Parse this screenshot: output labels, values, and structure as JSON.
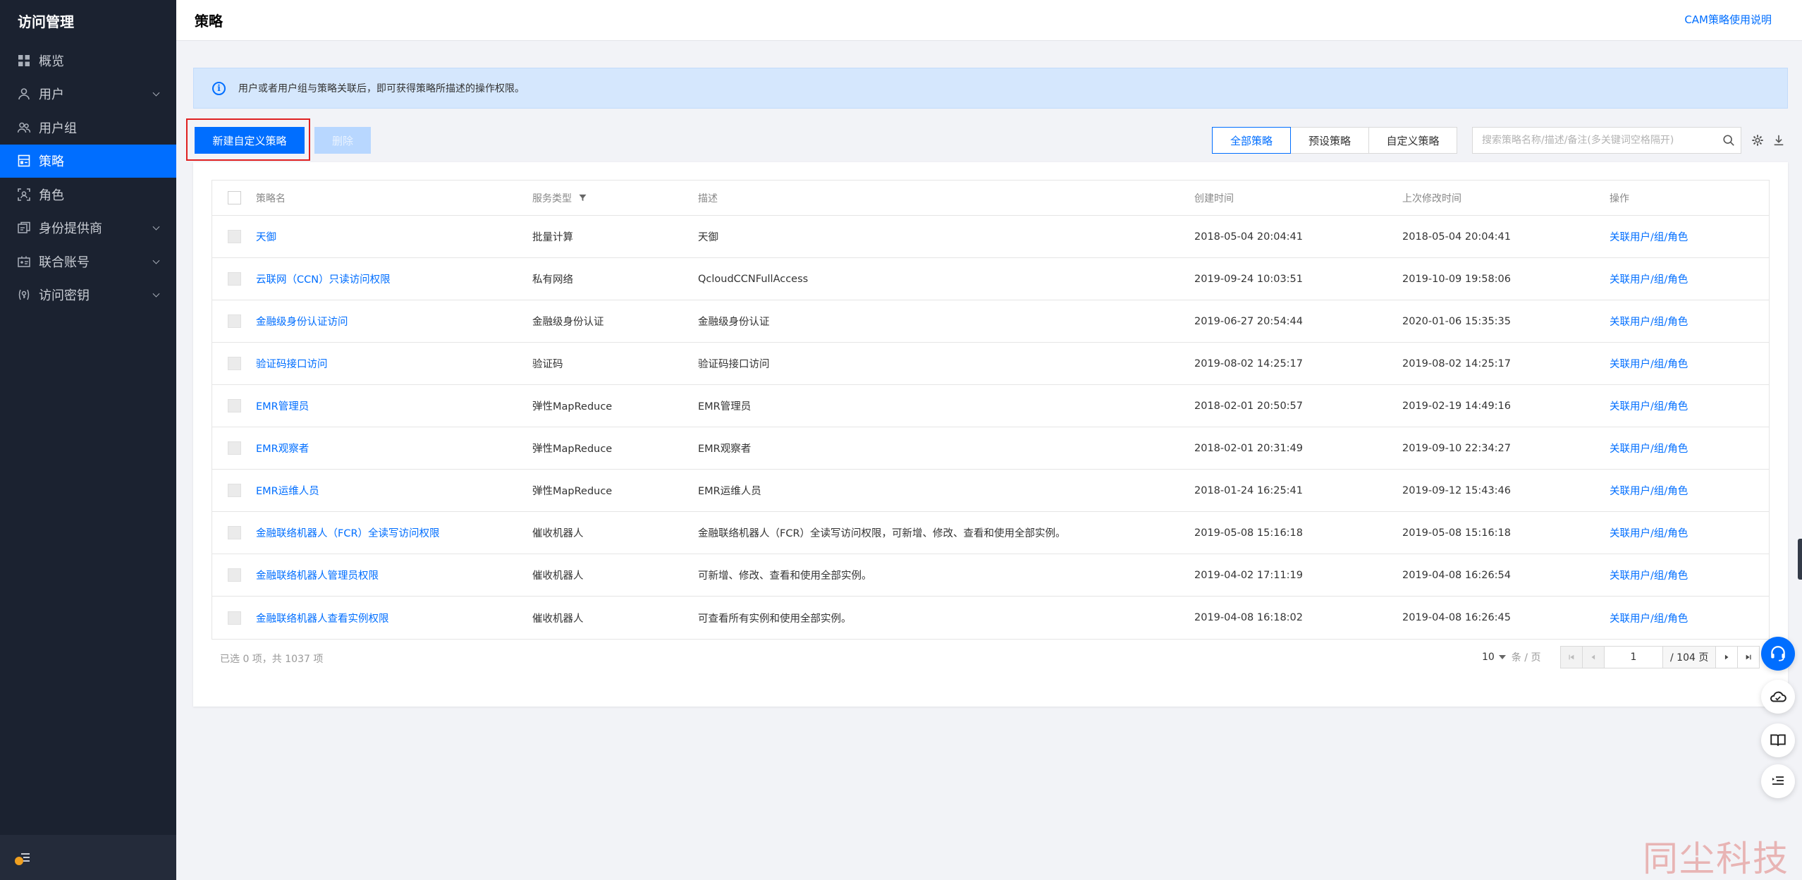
{
  "sidebar": {
    "title": "访问管理",
    "items": [
      {
        "label": "概览",
        "icon": "dashboard-icon",
        "active": false,
        "expandable": false
      },
      {
        "label": "用户",
        "icon": "user-icon",
        "active": false,
        "expandable": true
      },
      {
        "label": "用户组",
        "icon": "user-group-icon",
        "active": false,
        "expandable": false
      },
      {
        "label": "策略",
        "icon": "policy-icon",
        "active": true,
        "expandable": false
      },
      {
        "label": "角色",
        "icon": "role-icon",
        "active": false,
        "expandable": false
      },
      {
        "label": "身份提供商",
        "icon": "identity-provider-icon",
        "active": false,
        "expandable": true
      },
      {
        "label": "联合账号",
        "icon": "federated-account-icon",
        "active": false,
        "expandable": true
      },
      {
        "label": "访问密钥",
        "icon": "access-key-icon",
        "active": false,
        "expandable": true
      }
    ]
  },
  "header": {
    "title": "策略",
    "doc_link": "CAM策略使用说明"
  },
  "banner": {
    "text": "用户或者用户组与策略关联后，即可获得策略所描述的操作权限。"
  },
  "toolbar": {
    "create_label": "新建自定义策略",
    "delete_label": "删除",
    "filters": [
      "全部策略",
      "预设策略",
      "自定义策略"
    ],
    "active_filter": 0,
    "search_placeholder": "搜索策略名称/描述/备注(多关键词空格隔开)"
  },
  "table": {
    "headers": {
      "name": "策略名",
      "service": "服务类型",
      "description": "描述",
      "created": "创建时间",
      "updated": "上次修改时间",
      "operation": "操作"
    },
    "rows": [
      {
        "name": "天御",
        "service": "批量计算",
        "description": "天御",
        "created": "2018-05-04 20:04:41",
        "updated": "2018-05-04 20:04:41",
        "operation": "关联用户/组/角色"
      },
      {
        "name": "云联网（CCN）只读访问权限",
        "service": "私有网络",
        "description": "QcloudCCNFullAccess",
        "created": "2019-09-24 10:03:51",
        "updated": "2019-10-09 19:58:06",
        "operation": "关联用户/组/角色"
      },
      {
        "name": "金融级身份认证访问",
        "service": "金融级身份认证",
        "description": "金融级身份认证",
        "created": "2019-06-27 20:54:44",
        "updated": "2020-01-06 15:35:35",
        "operation": "关联用户/组/角色"
      },
      {
        "name": "验证码接口访问",
        "service": "验证码",
        "description": "验证码接口访问",
        "created": "2019-08-02 14:25:17",
        "updated": "2019-08-02 14:25:17",
        "operation": "关联用户/组/角色"
      },
      {
        "name": "EMR管理员",
        "service": "弹性MapReduce",
        "description": "EMR管理员",
        "created": "2018-02-01 20:50:57",
        "updated": "2019-02-19 14:49:16",
        "operation": "关联用户/组/角色"
      },
      {
        "name": "EMR观察者",
        "service": "弹性MapReduce",
        "description": "EMR观察者",
        "created": "2018-02-01 20:31:49",
        "updated": "2019-09-10 22:34:27",
        "operation": "关联用户/组/角色"
      },
      {
        "name": "EMR运维人员",
        "service": "弹性MapReduce",
        "description": "EMR运维人员",
        "created": "2018-01-24 16:25:41",
        "updated": "2019-09-12 15:43:46",
        "operation": "关联用户/组/角色"
      },
      {
        "name": "金融联络机器人（FCR）全读写访问权限",
        "service": "催收机器人",
        "description": "金融联络机器人（FCR）全读写访问权限，可新增、修改、查看和使用全部实例。",
        "created": "2019-05-08 15:16:18",
        "updated": "2019-05-08 15:16:18",
        "operation": "关联用户/组/角色"
      },
      {
        "name": "金融联络机器人管理员权限",
        "service": "催收机器人",
        "description": "可新增、修改、查看和使用全部实例。",
        "created": "2019-04-02 17:11:19",
        "updated": "2019-04-08 16:26:54",
        "operation": "关联用户/组/角色"
      },
      {
        "name": "金融联络机器人查看实例权限",
        "service": "催收机器人",
        "description": "可查看所有实例和使用全部实例。",
        "created": "2019-04-08 16:18:02",
        "updated": "2019-04-08 16:26:45",
        "operation": "关联用户/组/角色"
      }
    ]
  },
  "footer": {
    "selected_info": "已选 0 项，共 1037 项",
    "page_size": "10",
    "page_size_unit": "条 / 页",
    "current_page": "1",
    "total_pages": "/ 104 页"
  },
  "watermark": "同尘科技",
  "colors": {
    "accent": "#006eff",
    "sidebar_bg": "#1b2230",
    "banner_bg": "#d5e7fd",
    "highlight": "#e02020"
  }
}
